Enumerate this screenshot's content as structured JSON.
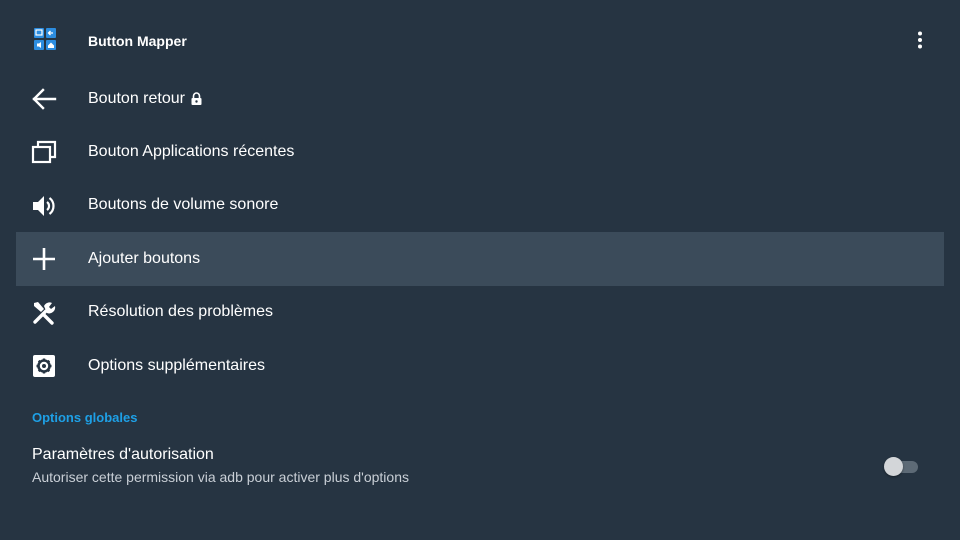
{
  "header": {
    "title": "Button Mapper",
    "logo_icon": "app-logo-icon",
    "overflow_icon": "more-vert-icon"
  },
  "menu": {
    "items": [
      {
        "label": "Bouton retour",
        "icon": "arrow-back-icon",
        "locked": true
      },
      {
        "label": "Bouton Applications récentes",
        "icon": "recent-apps-icon"
      },
      {
        "label": "Boutons de volume sonore",
        "icon": "volume-icon"
      },
      {
        "label": "Ajouter boutons",
        "icon": "plus-icon",
        "focused": true
      },
      {
        "label": "Résolution des problèmes",
        "icon": "tools-icon"
      },
      {
        "label": "Options supplémentaires",
        "icon": "settings-box-icon"
      }
    ]
  },
  "global_options": {
    "header": "Options globales",
    "authorization": {
      "title": "Paramètres d'autorisation",
      "summary": "Autoriser cette permission via adb pour activer plus d'options",
      "enabled": false
    }
  },
  "colors": {
    "background": "#263442",
    "focused_row": "#3b4b5a",
    "accent": "#1ea0e6",
    "logo_blue": "#2c8de0"
  }
}
